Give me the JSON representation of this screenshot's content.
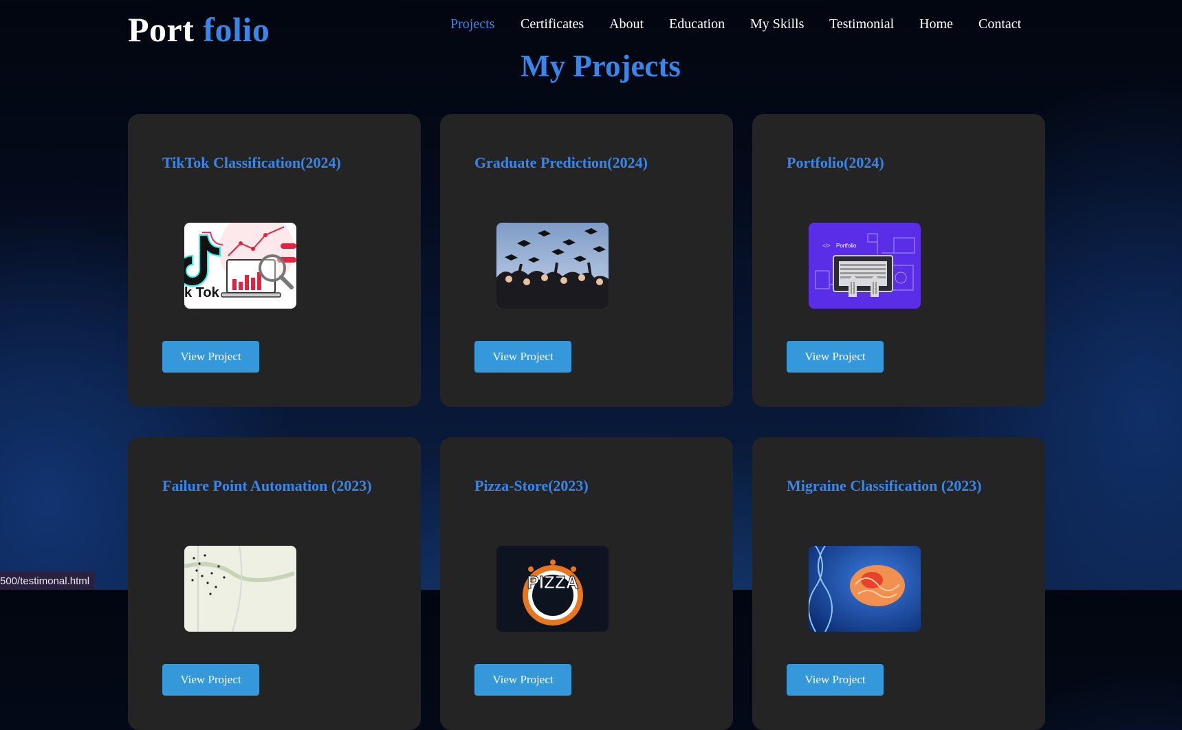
{
  "logo": {
    "part1": "Port",
    "part2": "folio"
  },
  "nav": {
    "items": [
      {
        "label": "Projects",
        "active": true
      },
      {
        "label": "Certificates"
      },
      {
        "label": "About"
      },
      {
        "label": "Education"
      },
      {
        "label": "My Skills"
      },
      {
        "label": "Testimonial"
      },
      {
        "label": "Home"
      },
      {
        "label": "Contact"
      }
    ]
  },
  "page": {
    "title": "My Projects"
  },
  "projects": [
    {
      "title": "TikTok Classification(2024)",
      "button": "View Project",
      "thumb_text": "k Tok"
    },
    {
      "title": "Graduate Prediction(2024)",
      "button": "View Project"
    },
    {
      "title": "Portfolio(2024)",
      "button": "View Project",
      "thumb_text": "Portfolio"
    },
    {
      "title": "Failure Point Automation (2023)",
      "button": "View Project"
    },
    {
      "title": "Pizza-Store(2023)",
      "button": "View Project",
      "thumb_text": "PIZZA"
    },
    {
      "title": "Migraine Classification (2023)",
      "button": "View Project"
    }
  ],
  "status_bar": {
    "url": "500/testimonal.html"
  },
  "colors": {
    "accent": "#3a86e8",
    "card": "#242424",
    "button": "#3498db"
  }
}
